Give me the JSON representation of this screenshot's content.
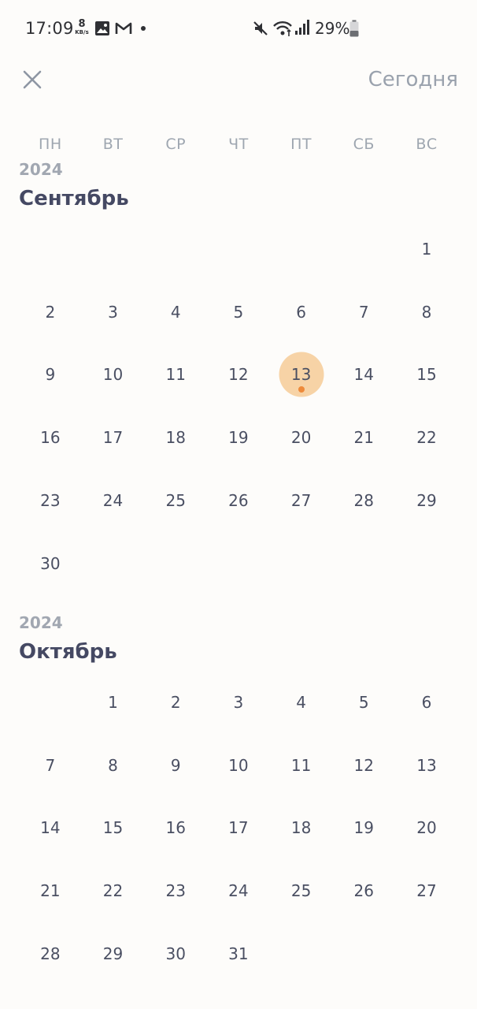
{
  "status_bar": {
    "time": "17:09",
    "net_speed_value": "8",
    "net_speed_unit": "KB/s",
    "battery": "29%"
  },
  "header": {
    "today_label": "Сегодня"
  },
  "weekdays": [
    "ПН",
    "ВТ",
    "СР",
    "ЧТ",
    "ПТ",
    "СБ",
    "ВС"
  ],
  "colors": {
    "selected_bg": "#f7d3a6",
    "event_dot": "#ee8a3a",
    "month_title": "#454963",
    "muted": "#9ea6b0"
  },
  "months": [
    {
      "year": "2024",
      "name": "Сентябрь",
      "leading_blanks": 6,
      "days": 30,
      "selected_day": 13,
      "event_days": [
        13
      ]
    },
    {
      "year": "2024",
      "name": "Октябрь",
      "leading_blanks": 1,
      "days": 31,
      "selected_day": null,
      "event_days": []
    }
  ]
}
